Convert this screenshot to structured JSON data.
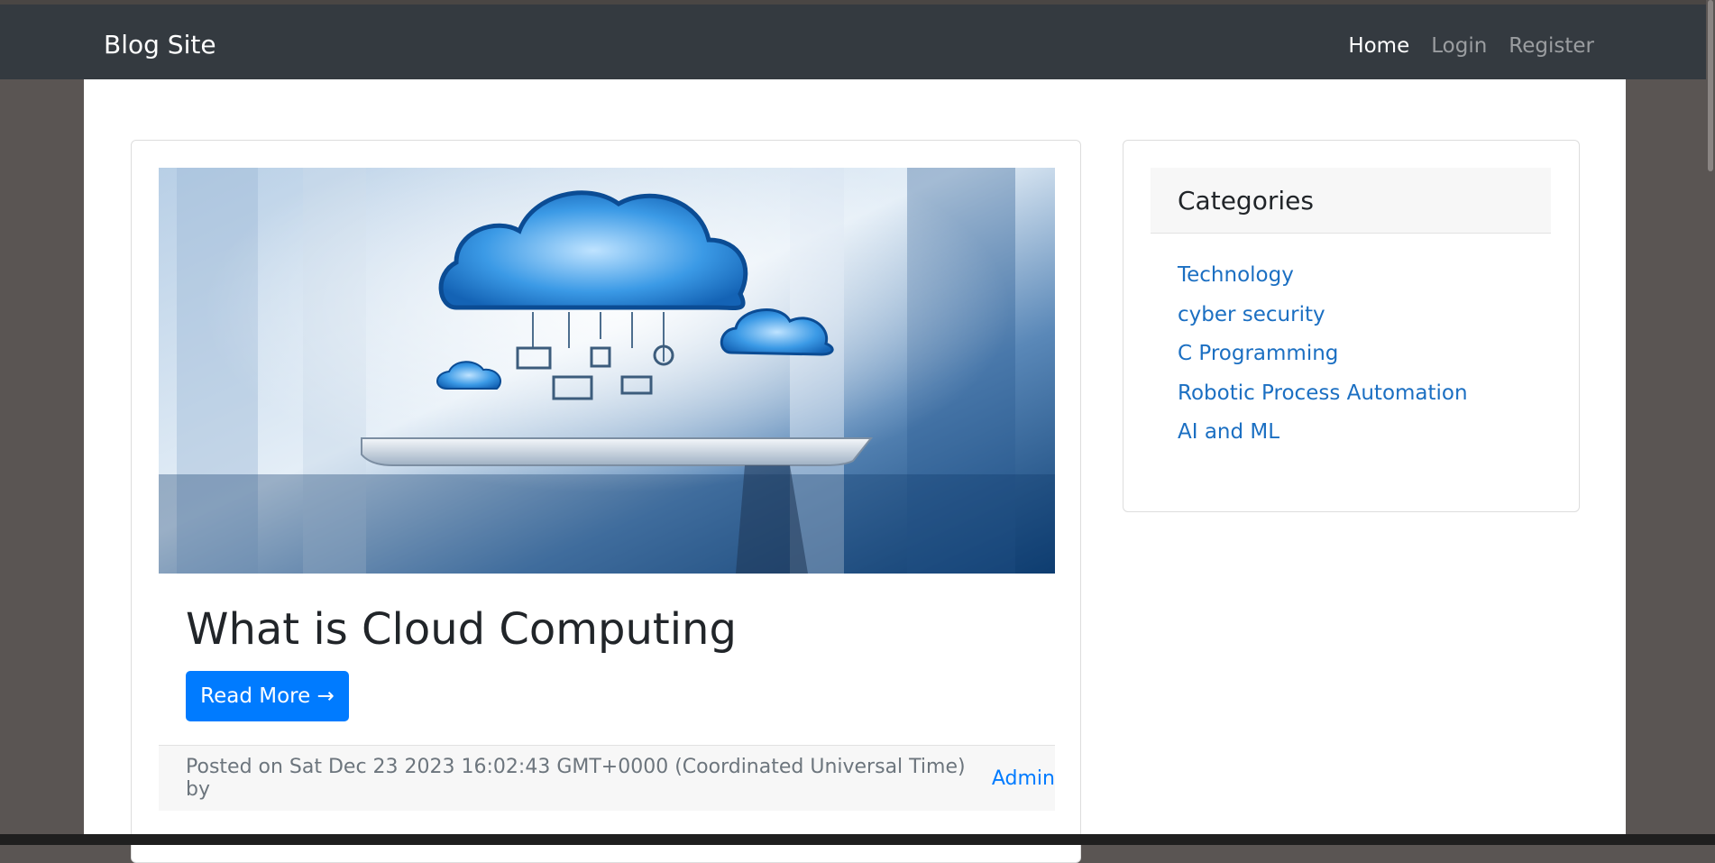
{
  "navbar": {
    "brand": "Blog Site",
    "links": [
      {
        "label": "Home",
        "active": true
      },
      {
        "label": "Login",
        "active": false
      },
      {
        "label": "Register",
        "active": false
      }
    ]
  },
  "post": {
    "image_subject": "cloud-computing-illustration",
    "title": "What is Cloud Computing",
    "read_more_label": "Read More →",
    "posted_text": "Posted on Sat Dec 23 2023 16:02:43 GMT+0000 (Coordinated Universal Time) by",
    "author": "Admin"
  },
  "sidebar": {
    "title": "Categories",
    "categories": [
      "Technology",
      "cyber security",
      "C Programming",
      "Robotic Process Automation",
      "AI and ML"
    ]
  },
  "colors": {
    "navbar_bg": "#343a40",
    "primary": "#007bff",
    "link": "#1b6fc2"
  }
}
